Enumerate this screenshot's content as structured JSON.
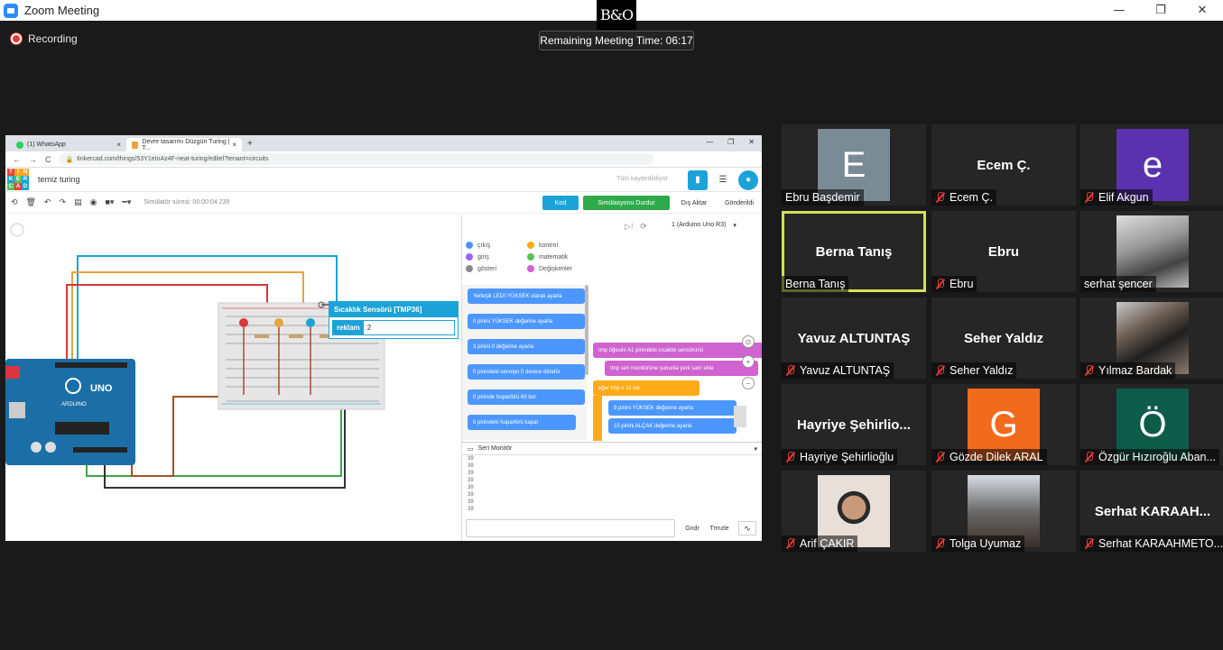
{
  "window": {
    "title": "Zoom Meeting",
    "controls": [
      "—",
      "❐",
      "✕"
    ]
  },
  "brand_logo": "B&O",
  "recording_label": "Recording",
  "remaining_time": "Remaining Meeting Time: 06:17",
  "browser": {
    "tabs": [
      {
        "label": "(1) WhatsApp",
        "close": "×"
      },
      {
        "label": "Devre tasarımı Düzgün Turing | T...",
        "close": "×"
      }
    ],
    "new_tab": "+",
    "url": "tinkercad.com/things/53Y1eInAz4F-neat-turing/editel?tenant=circuits",
    "win_controls": [
      "—",
      "❐",
      "✕"
    ],
    "nav": [
      "←",
      "→",
      "C"
    ]
  },
  "tinkercad": {
    "logo_letters": [
      "T",
      "I",
      "N",
      "K",
      "E",
      "R",
      "C",
      "A",
      "D"
    ],
    "project_title": "temiz turing",
    "saved_status": "Tüm kaydedildiyor",
    "sim_time": "Simülatör süresi: 00:00:04.239",
    "code_button": "Kod",
    "stop_button": "Simülasyonu Durdur",
    "export_button": "Dış Aktar",
    "send_button": "Gönderildi",
    "board_select": "1 (Arduino Uno R3)",
    "sensor_popup": {
      "title": "Sıcaklık Sensörü [TMP36]",
      "label": "reklam",
      "value": "2"
    },
    "categories": [
      {
        "name": "çıkış",
        "color": "#4c97ff"
      },
      {
        "name": "kontrol",
        "color": "#ffab19"
      },
      {
        "name": "giriş",
        "color": "#9966ff"
      },
      {
        "name": "matematik",
        "color": "#59c059"
      },
      {
        "name": "gösteri",
        "color": "#888888"
      },
      {
        "name": "Değişkenler",
        "color": "#cf63cf"
      }
    ],
    "blocks_left": [
      "Yerleşik LED'i YÜKSEK olarak ayarla",
      "0 pinini YÜKSEK değerine ayarla",
      "3 pinini 0 değerine ayarla",
      "0 pinindeki servoyu 0 derece döndür",
      "0 pininde hoparlörü 60 ton",
      "0 pinindeki hoparlörü kapat"
    ],
    "blocks_right": [
      "tmp öğesini A1 pinindeki sıcaklık sensörünü",
      "tmp seri monitörüne şununla yeni satır ekle",
      "eğer tmp ≤ 11 ise",
      "9 pinini YÜKSEK değerine ayarla",
      "10 pinini ALÇAK değerine ayarla"
    ],
    "serial_title": "Seri Monitör",
    "serial_lines": [
      "39",
      "39",
      "39",
      "39",
      "39",
      "39",
      "39",
      "39"
    ],
    "serial_send": "Gndr",
    "serial_clear": "Trmzle",
    "arduino_label": "UNO",
    "arduino_brand": "ARDUINO"
  },
  "participants": [
    {
      "name": "Ebru Başdemir",
      "display": "E",
      "avatar_color": "#7b8b96",
      "muted": false,
      "type": "letter"
    },
    {
      "name": "Ecem Ç.",
      "display": "Ecem Ç.",
      "muted": true,
      "type": "text"
    },
    {
      "name": "Elif Akgun",
      "display": "e",
      "avatar_color": "#5a32b0",
      "muted": true,
      "type": "letter"
    },
    {
      "name": "Berna Tanış",
      "display": "Berna Tanış",
      "muted": false,
      "type": "text",
      "active": true
    },
    {
      "name": "Ebru",
      "display": "Ebru",
      "muted": true,
      "type": "text"
    },
    {
      "name": "serhat şencer",
      "muted": false,
      "type": "photo"
    },
    {
      "name": "Yavuz ALTUNTAŞ",
      "display": "Yavuz ALTUNTAŞ",
      "muted": true,
      "type": "text"
    },
    {
      "name": "Seher Yaldız",
      "display": "Seher Yaldız",
      "muted": true,
      "type": "text"
    },
    {
      "name": "Yılmaz Bardak",
      "muted": true,
      "type": "photo"
    },
    {
      "name": "Hayriye Şehirlioğlu",
      "display": "Hayriye Şehirlio...",
      "muted": true,
      "type": "text"
    },
    {
      "name": "Gözde Dilek ARAL",
      "display": "G",
      "avatar_color": "#f26b1d",
      "muted": true,
      "type": "letter"
    },
    {
      "name": "Özgür Hızıroğlu Aban...",
      "display": "Ö",
      "avatar_color": "#0d5c4a",
      "muted": true,
      "type": "letter"
    },
    {
      "name": "Arif ÇAKIR",
      "muted": true,
      "type": "photo"
    },
    {
      "name": "Tolga Uyumaz",
      "muted": true,
      "type": "photo"
    },
    {
      "name": "Serhat KARAAHMETO...",
      "display": "Serhat KARAAH...",
      "muted": true,
      "type": "text"
    }
  ]
}
